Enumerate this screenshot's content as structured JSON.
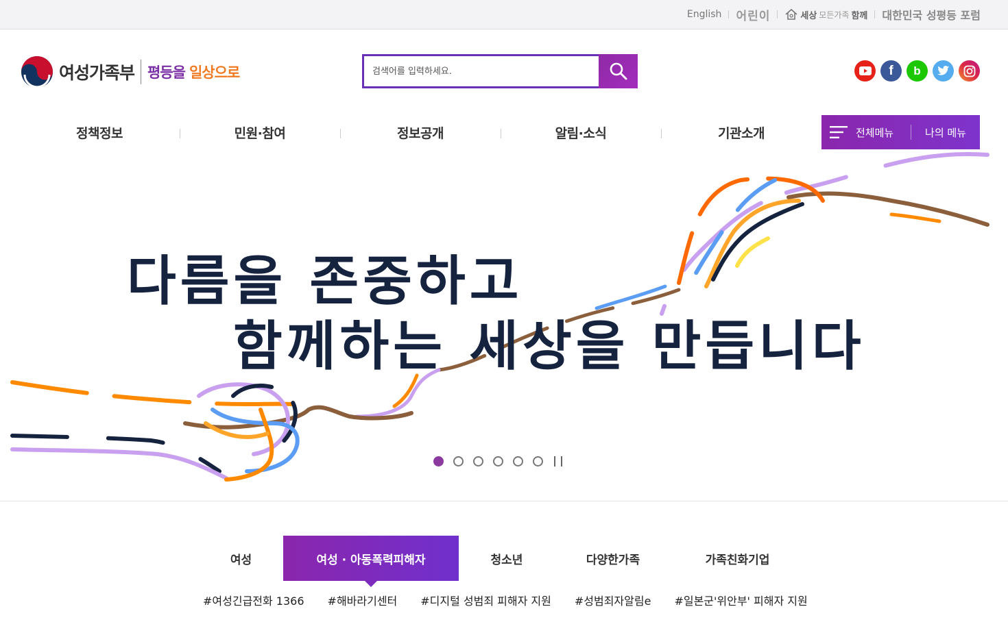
{
  "utility": {
    "english": "English",
    "kids": "어린이",
    "family_prefix": "세상",
    "family_middle": "모든가족",
    "family_suffix": "함께",
    "forum": "대한민국 성평등 포럼"
  },
  "header": {
    "ministry_name": "여성가족부",
    "slogan_part1": "평등을",
    "slogan_part2": "일상으로"
  },
  "search": {
    "placeholder": "검색어를 입력하세요."
  },
  "social": [
    "youtube-icon",
    "facebook-icon",
    "blog-icon",
    "twitter-icon",
    "instagram-icon"
  ],
  "social_glyphs": {
    "facebook": "f",
    "blog": "b"
  },
  "gnb": {
    "items": [
      "정책정보",
      "민원·참여",
      "정보공개",
      "알림·소식",
      "기관소개"
    ],
    "all_menu": "전체메뉴",
    "my_menu": "나의 메뉴"
  },
  "banner": {
    "line1": "다름을 존중하고",
    "line2": "함께하는 세상을 만듭니다",
    "slides_total": 6,
    "slide_active": 1
  },
  "category": {
    "tabs": [
      "여성",
      "여성 · 아동폭력피해자",
      "청소년",
      "다양한가족",
      "가족친화기업"
    ],
    "active_index": 1,
    "tags": [
      "#여성긴급전화 1366",
      "#해바라기센터",
      "#디지털 성범죄 피해자 지원",
      "#성범죄자알림e",
      "#일본군'위안부' 피해자 지원"
    ]
  },
  "colors": {
    "brand_purple": "#8b26ad",
    "search_border": "#6a2fb4",
    "banner_text": "#15233f",
    "slogan_orange": "#f07a22"
  }
}
